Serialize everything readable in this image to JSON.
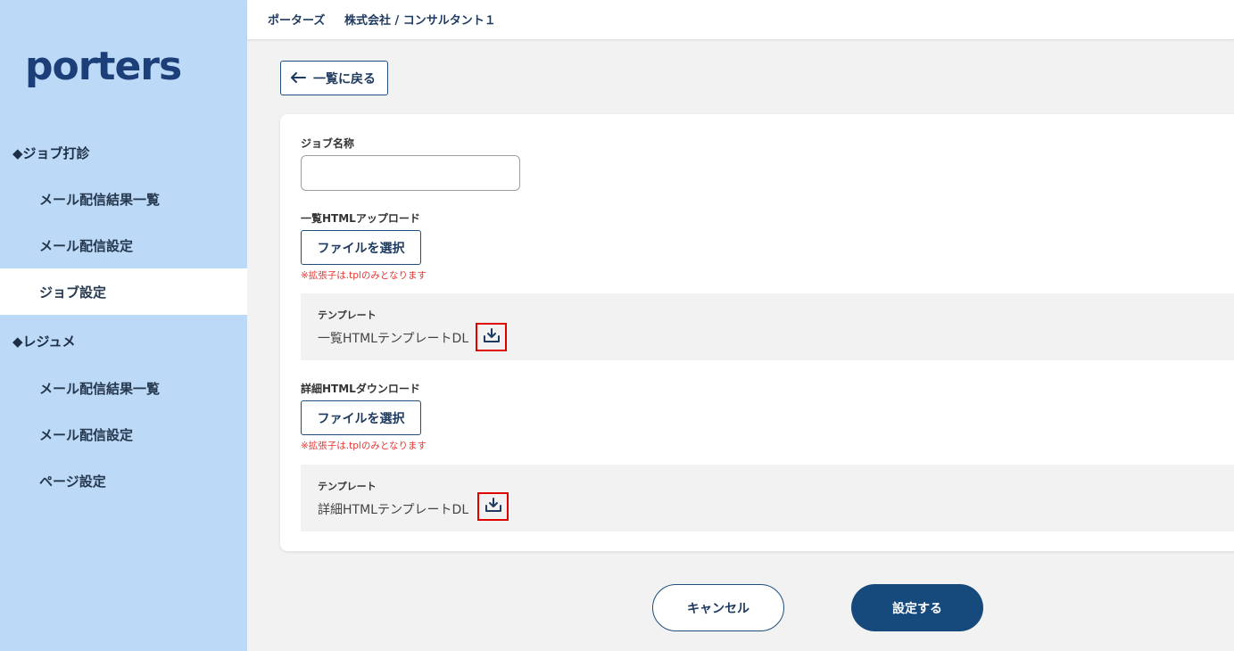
{
  "brand": {
    "logo_text": "porters"
  },
  "header": {
    "breadcrumb_home": "ポーターズ",
    "breadcrumb_user": "株式会社 / コンサルタント１"
  },
  "sidebar": {
    "sections": [
      {
        "label": "◆ジョブ打診"
      },
      {
        "label": "◆レジュメ"
      }
    ],
    "items": [
      {
        "label": "メール配信結果一覧"
      },
      {
        "label": "メール配信設定"
      },
      {
        "label": "ジョブ設定"
      },
      {
        "label": "メール配信結果一覧"
      },
      {
        "label": "メール配信設定"
      },
      {
        "label": "ページ設定"
      }
    ]
  },
  "main": {
    "back_label": "一覧に戻る",
    "job_name_label": "ジョブ名称",
    "job_name_value": "",
    "list_upload": {
      "label": "一覧HTMLアップロード",
      "file_button": "ファイルを選択",
      "note": "※拡張子は.tplのみとなります",
      "template_title": "テンプレート",
      "template_link": "一覧HTMLテンプレートDL"
    },
    "detail_upload": {
      "label": "詳細HTMLダウンロード",
      "file_button": "ファイルを選択",
      "note": "※拡張子は.tplのみとなります",
      "template_title": "テンプレート",
      "template_link": "詳細HTMLテンプレートDL"
    }
  },
  "footer": {
    "cancel_label": "キャンセル",
    "submit_label": "設定する"
  },
  "colors": {
    "sidebar_bg": "#bcd9f7",
    "primary": "#174a7c",
    "note_red": "#e53935",
    "highlight_box": "#e00000"
  }
}
